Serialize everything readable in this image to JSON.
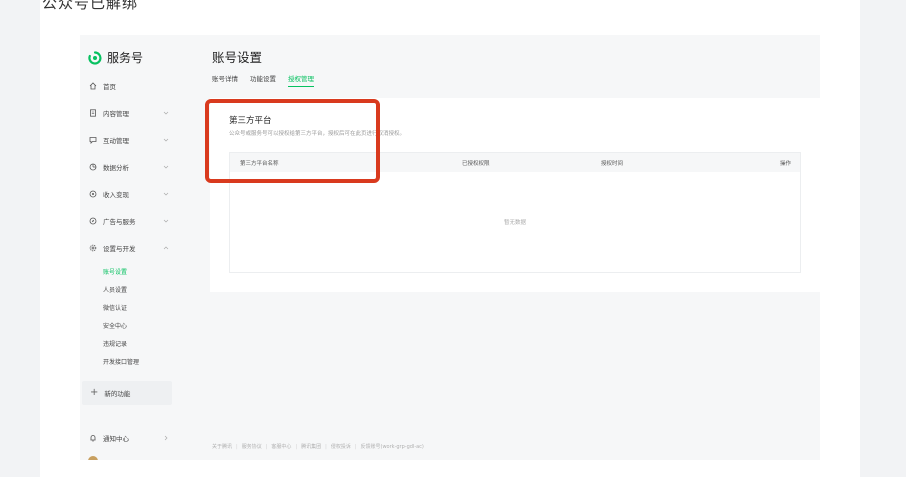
{
  "caption": "公众号已解绑",
  "brand": {
    "name": "服务号",
    "accent": "#07c160"
  },
  "nav": [
    {
      "label": "首页",
      "icon": "home-icon"
    },
    {
      "label": "内容管理",
      "icon": "document-icon"
    },
    {
      "label": "互动管理",
      "icon": "chat-icon"
    },
    {
      "label": "数据分析",
      "icon": "chart-icon"
    },
    {
      "label": "收入变现",
      "icon": "money-icon"
    },
    {
      "label": "广告与服务",
      "icon": "compass-icon"
    },
    {
      "label": "设置与开发",
      "icon": "gear-icon"
    }
  ],
  "sub_nav": [
    "账号设置",
    "人员设置",
    "微信认证",
    "安全中心",
    "违规记录",
    "开发接口管理"
  ],
  "new_func": "新的功能",
  "notify": "通知中心",
  "main": {
    "title": "账号设置",
    "tabs": [
      "账号详情",
      "功能设置",
      "授权管理"
    ],
    "section_title": "第三方平台",
    "section_desc": "公众号或服务号可以授权给第三方平台，授权后可在此页进行取消授权。",
    "table": {
      "headers": [
        "第三方平台名称",
        "已授权权限",
        "授权时间",
        "操作"
      ],
      "empty": "暂无数据"
    }
  },
  "footer": [
    "关于腾讯",
    "服务协议",
    "客服中心",
    "腾讯集团",
    "侵权投诉",
    "反馈账号(work-grp-gdl-ac)"
  ],
  "colors": {
    "highlight": "#d93a1e",
    "active": "#07c160"
  }
}
